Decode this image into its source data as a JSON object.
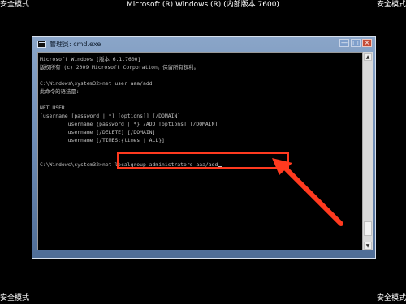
{
  "screen": {
    "corner_top_left": "安全模式",
    "title": "Microsoft (R) Windows (R) (内部版本 7600)",
    "corner_top_right": "安全模式",
    "corner_bottom_left": "安全模式",
    "corner_bottom_right": "安全模式"
  },
  "window": {
    "title": "管理员: cmd.exe",
    "controls": {
      "minimize": "—",
      "maximize": "□",
      "close": "×"
    }
  },
  "console": {
    "lines": [
      "Microsoft Windows [版本 6.1.7600]",
      "版权所有 (c) 2009 Microsoft Corporation。保留所有权利。",
      "",
      "C:\\Windows\\system32>net user aaa/add",
      "此命令的语法是:",
      "",
      "NET USER",
      "[username [password | *] [options]] [/DOMAIN]",
      "         username {password | *} /ADD [options] [/DOMAIN]",
      "         username [/DELETE] [/DOMAIN]",
      "         username [/TIMES:{times | ALL}]",
      "",
      "",
      "C:\\Windows\\system32>net localgroup administrators aaa/add"
    ]
  },
  "icons": {
    "window_icon": "command-prompt-icon",
    "annotation_arrow": "red-arrow-annotation-icon",
    "scroll_up": "scroll-up-icon",
    "scroll_down": "scroll-down-icon"
  },
  "colors": {
    "background": "#000000",
    "window_frame": "#6f8db6",
    "console_text": "#c0c0c0",
    "annotation_red": "#ff3a1f"
  }
}
